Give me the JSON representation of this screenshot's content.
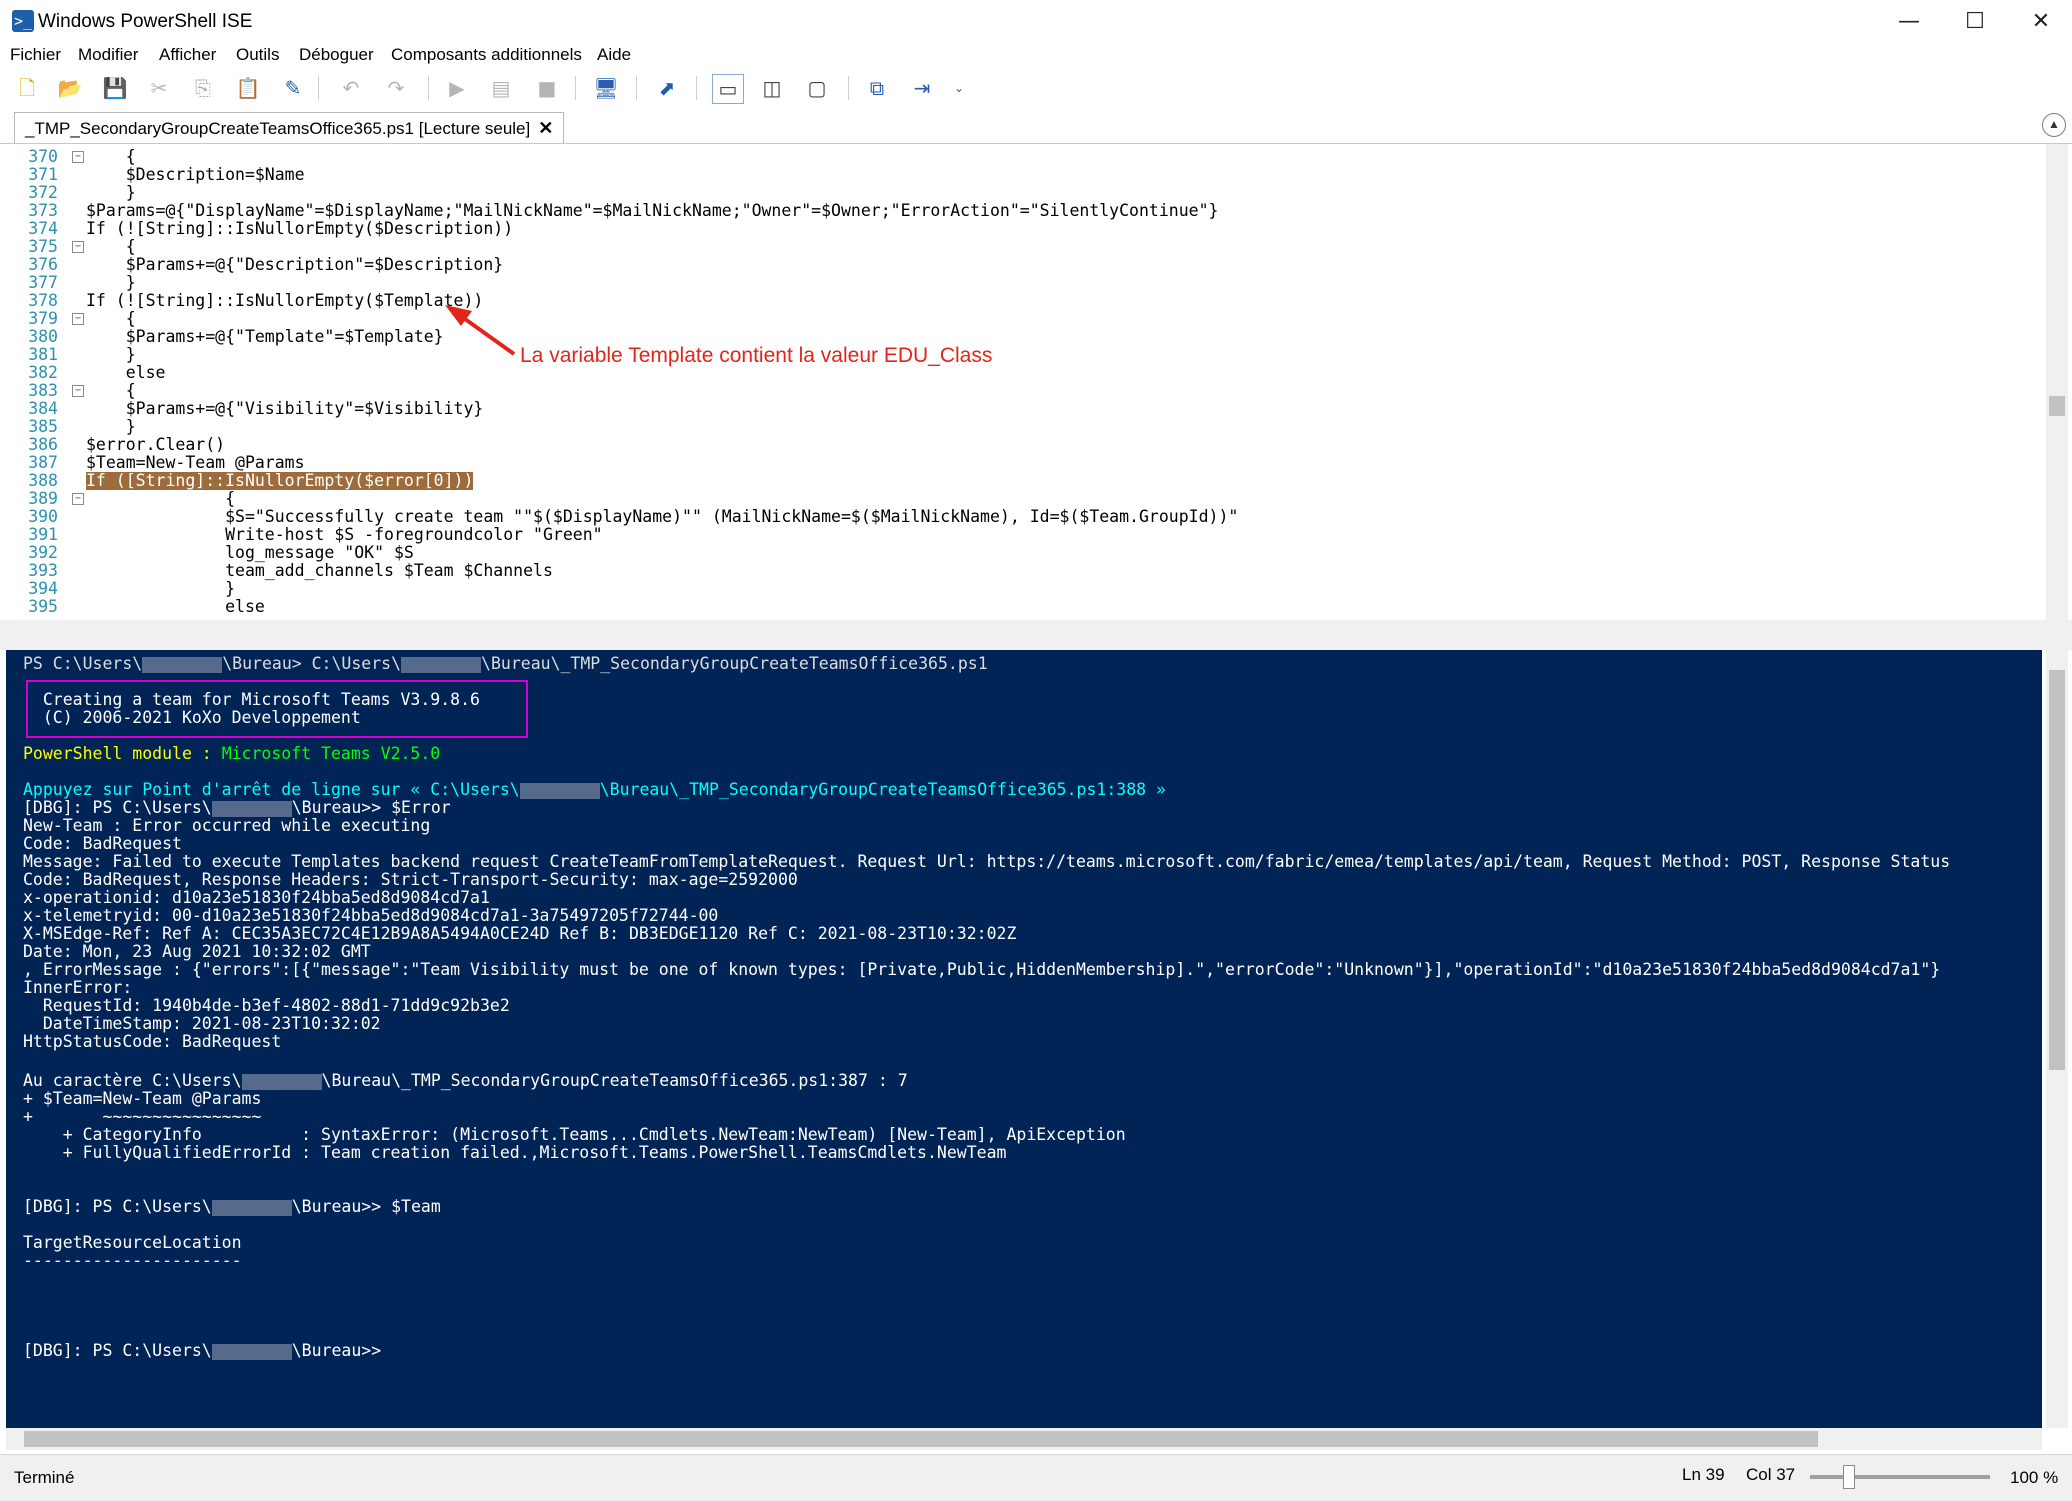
{
  "window": {
    "title": "Windows PowerShell ISE",
    "minimize": "—",
    "maximize": "☐",
    "close": "✕"
  },
  "menu": [
    "Fichier",
    "Modifier",
    "Afficher",
    "Outils",
    "Déboguer",
    "Composants additionnels",
    "Aide"
  ],
  "tab": {
    "label": "_TMP_SecondaryGroupCreateTeamsOffice365.ps1 [Lecture seule]",
    "close": "✕"
  },
  "annotation": "La variable Template contient la valeur EDU_Class",
  "editor_lines": [
    {
      "n": "370",
      "fold": "−",
      "code": "    {"
    },
    {
      "n": "371",
      "fold": "",
      "code": "    $Description=$Name"
    },
    {
      "n": "372",
      "fold": "",
      "code": "    }"
    },
    {
      "n": "373",
      "fold": "",
      "code": "$Params=@{\"DisplayName\"=$DisplayName;\"MailNickName\"=$MailNickName;\"Owner\"=$Owner;\"ErrorAction\"=\"SilentlyContinue\"}"
    },
    {
      "n": "374",
      "fold": "",
      "code": "If (![String]::IsNullorEmpty($Description))"
    },
    {
      "n": "375",
      "fold": "−",
      "code": "    {"
    },
    {
      "n": "376",
      "fold": "",
      "code": "    $Params+=@{\"Description\"=$Description}"
    },
    {
      "n": "377",
      "fold": "",
      "code": "    }"
    },
    {
      "n": "378",
      "fold": "",
      "code": "If (![String]::IsNullorEmpty($Template))"
    },
    {
      "n": "379",
      "fold": "−",
      "code": "    {"
    },
    {
      "n": "380",
      "fold": "",
      "code": "    $Params+=@{\"Template\"=$Template}"
    },
    {
      "n": "381",
      "fold": "",
      "code": "    }"
    },
    {
      "n": "382",
      "fold": "",
      "code": "    else"
    },
    {
      "n": "383",
      "fold": "−",
      "code": "    {"
    },
    {
      "n": "384",
      "fold": "",
      "code": "    $Params+=@{\"Visibility\"=$Visibility}"
    },
    {
      "n": "385",
      "fold": "",
      "code": "    }"
    },
    {
      "n": "386",
      "fold": "",
      "code": "$error.Clear()"
    },
    {
      "n": "387",
      "fold": "",
      "code": "$Team=New-Team @Params"
    },
    {
      "n": "388",
      "fold": "",
      "code": "If ([String]::IsNullorEmpty($error[0]))"
    },
    {
      "n": "389",
      "fold": "−",
      "code": "              {"
    },
    {
      "n": "390",
      "fold": "",
      "code": "              $S=\"Successfully create team \"\"$($DisplayName)\"\" (MailNickName=$($MailNickName), Id=$($Team.GroupId))\""
    },
    {
      "n": "391",
      "fold": "",
      "code": "              Write-host $S -foregroundcolor \"Green\""
    },
    {
      "n": "392",
      "fold": "",
      "code": "              log_message \"OK\" $S"
    },
    {
      "n": "393",
      "fold": "",
      "code": "              team_add_channels $Team $Channels"
    },
    {
      "n": "394",
      "fold": "",
      "code": "              }"
    },
    {
      "n": "395",
      "fold": "",
      "code": "              else"
    }
  ],
  "console": {
    "prompt1_a": "PS C:\\Users\\",
    "prompt1_b": "\\Bureau> C:\\Users\\",
    "prompt1_c": "\\Bureau\\_TMP_SecondaryGroupCreateTeamsOffice365.ps1",
    "banner1": "  Creating a team for Microsoft Teams V3.9.8.6",
    "banner2": "  (C) 2006-2021 KoXo Developpement",
    "module_label": "PowerShell module : ",
    "module_value": "Microsoft Teams V2.5.0",
    "breakpoint_a": "Appuyez sur Point d'arrêt de ligne sur « C:\\Users\\",
    "breakpoint_b": "\\Bureau\\_TMP_SecondaryGroupCreateTeamsOffice365.ps1:388 »",
    "dbg1_a": "[DBG]: PS C:\\Users\\",
    "dbg1_b": "\\Bureau>> $Error",
    "error_lines": [
      "New-Team : Error occurred while executing",
      "Code: BadRequest",
      "Message: Failed to execute Templates backend request CreateTeamFromTemplateRequest. Request Url: https://teams.microsoft.com/fabric/emea/templates/api/team, Request Method: POST, Response Status",
      "Code: BadRequest, Response Headers: Strict-Transport-Security: max-age=2592000",
      "x-operationid: d10a23e51830f24bba5ed8d9084cd7a1",
      "x-telemetryid: 00-d10a23e51830f24bba5ed8d9084cd7a1-3a75497205f72744-00",
      "X-MSEdge-Ref: Ref A: CEC35A3EC72C4E12B9A8A5494A0CE24D Ref B: DB3EDGE1120 Ref C: 2021-08-23T10:32:02Z",
      "Date: Mon, 23 Aug 2021 10:32:02 GMT",
      ", ErrorMessage : {\"errors\":[{\"message\":\"Team Visibility must be one of known types: [Private,Public,HiddenMembership].\",\"errorCode\":\"Unknown\"}],\"operationId\":\"d10a23e51830f24bba5ed8d9084cd7a1\"}",
      "InnerError:",
      "  RequestId: 1940b4de-b3ef-4802-88d1-71dd9c92b3e2",
      "  DateTimeStamp: 2021-08-23T10:32:02",
      "HttpStatusCode: BadRequest"
    ],
    "at_a": "Au caractère C:\\Users\\",
    "at_b": "\\Bureau\\_TMP_SecondaryGroupCreateTeamsOffice365.ps1:387 : 7",
    "trace_lines": [
      "+ $Team=New-Team @Params",
      "+       ~~~~~~~~~~~~~~~~",
      "    + CategoryInfo          : SyntaxError: (Microsoft.Teams...Cmdlets.NewTeam:NewTeam) [New-Team], ApiException",
      "    + FullyQualifiedErrorId : Team creation failed.,Microsoft.Teams.PowerShell.TeamsCmdlets.NewTeam"
    ],
    "dbg2_a": "[DBG]: PS C:\\Users\\",
    "dbg2_b": "\\Bureau>> $Team",
    "prop_header": "TargetResourceLocation",
    "prop_underline": "----------------------",
    "dbg3_a": "[DBG]: PS C:\\Users\\",
    "dbg3_b": "\\Bureau>>"
  },
  "status": {
    "left": "Terminé",
    "ln": "Ln 39",
    "col": "Col 37",
    "zoom": "100 %"
  }
}
